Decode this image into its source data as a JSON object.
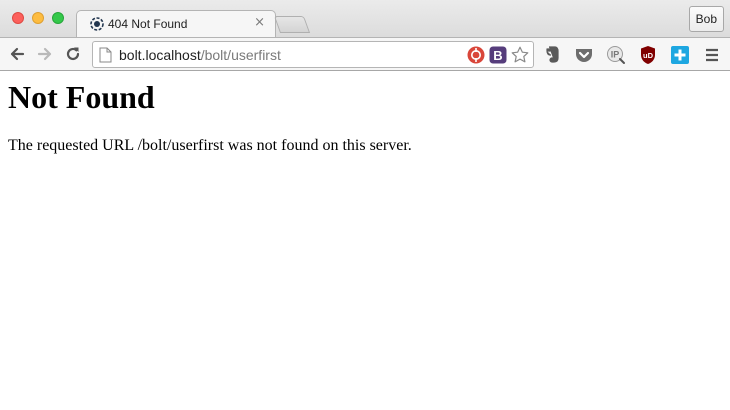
{
  "browser": {
    "tab": {
      "title": "404 Not Found",
      "close_glyph": "×",
      "favicon": "bolt-logo-icon"
    },
    "profile": {
      "name": "Bob"
    },
    "omnibox": {
      "url_host": "bolt.localhost",
      "url_path": "/bolt/userfirst"
    },
    "extensions": [
      "lastpass-icon",
      "bootstrap-icon",
      "bookmark-star-icon",
      "evernote-icon",
      "pocket-icon",
      "ip-lookup-icon",
      "ublock-icon",
      "plus-extension-icon",
      "hamburger-menu-icon"
    ],
    "extension_labels": {
      "bootstrap": "B",
      "ip": "IP",
      "ublock": "uD"
    },
    "colors": {
      "close_red": "#fc605c",
      "minimize_yellow": "#fdbc40",
      "zoom_green": "#34c84a",
      "lastpass_red": "#d9463a",
      "bootstrap_purple": "#563d7c",
      "pocket_gray": "#6d6d6d",
      "ublock_red": "#800000",
      "plus_cyan": "#1ea7e1"
    }
  },
  "page": {
    "heading": "Not Found",
    "message": "The requested URL /bolt/userfirst was not found on this server."
  }
}
